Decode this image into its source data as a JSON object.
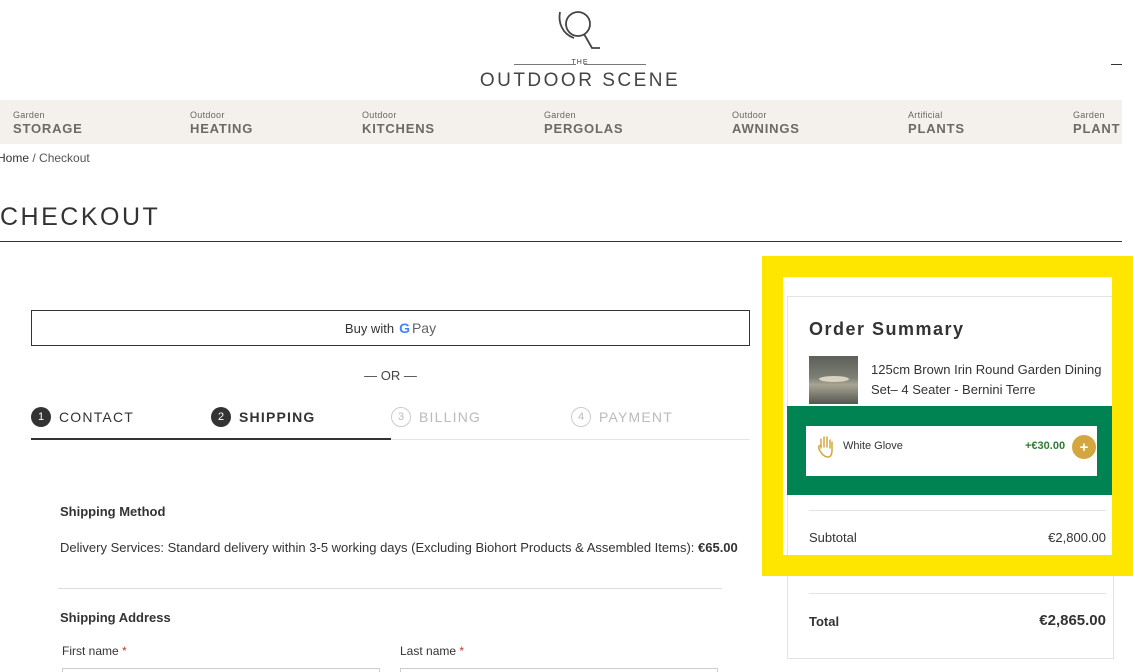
{
  "header": {
    "logo_the": "THE",
    "logo_brand": "OUTDOOR SCENE",
    "menu_icon": "menu-icon"
  },
  "nav": [
    {
      "small": "Garden",
      "big": "STORAGE"
    },
    {
      "small": "Outdoor",
      "big": "HEATING"
    },
    {
      "small": "Outdoor",
      "big": "KITCHENS"
    },
    {
      "small": "Garden",
      "big": "PERGOLAS"
    },
    {
      "small": "Outdoor",
      "big": "AWNINGS"
    },
    {
      "small": "Artificial",
      "big": "PLANTS"
    },
    {
      "small": "Garden",
      "big": "PLANT"
    }
  ],
  "breadcrumb": {
    "home": "Home",
    "sep": " / ",
    "current": "Checkout"
  },
  "page_title": "CHECKOUT",
  "express": {
    "buy_with": "Buy with",
    "g": "G",
    "pay": "Pay",
    "or": "— OR —"
  },
  "steps": [
    {
      "num": "1",
      "label": "CONTACT"
    },
    {
      "num": "2",
      "label": "SHIPPING"
    },
    {
      "num": "3",
      "label": "BILLING"
    },
    {
      "num": "4",
      "label": "PAYMENT"
    }
  ],
  "shipping": {
    "method_title": "Shipping Method",
    "method_text": "Delivery Services: Standard delivery within 3-5 working days (Excluding Biohort Products & Assembled Items): ",
    "method_price": "€65.00",
    "address_title": "Shipping Address",
    "first_name": "First name",
    "last_name": "Last name",
    "required": "*"
  },
  "summary": {
    "title": "Order Summary",
    "product_name": "125cm Brown Irin Round Garden Dining Set– 4 Seater - Bernini Terre",
    "addon_name": "White Glove",
    "addon_price": "+€30.00",
    "addon_add": "+",
    "subtotal_label": "Subtotal",
    "subtotal_value": "€2,800.00",
    "total_label": "Total",
    "total_value": "€2,865.00"
  },
  "colors": {
    "highlight_yellow": "#ffe600",
    "addon_green": "#008352",
    "add_button_gold": "#d4a640",
    "price_green": "#2e7d32",
    "nav_bg": "#f4f1ed"
  }
}
